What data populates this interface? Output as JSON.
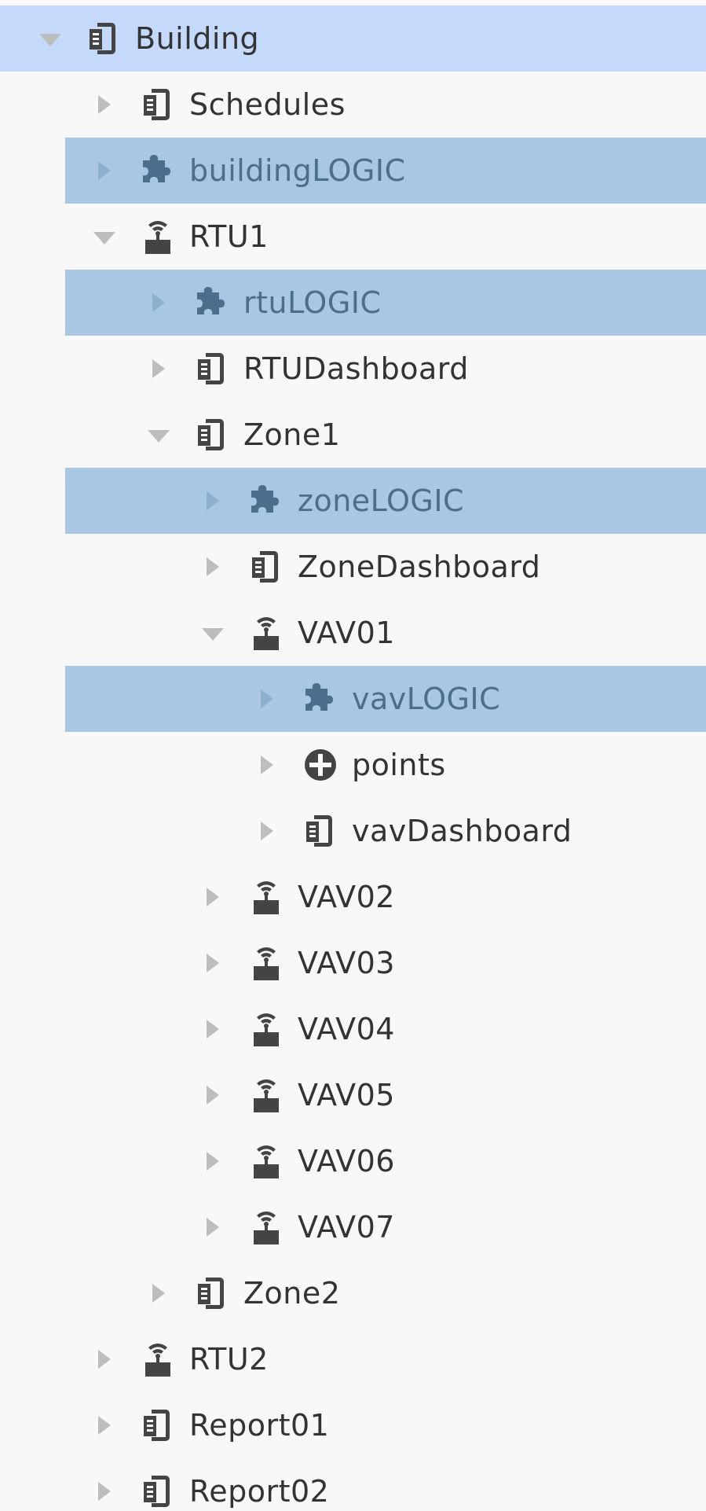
{
  "colors": {
    "root_selected_bg": "#c5d9fb",
    "logic_highlight_bg": "#a9c6e3",
    "label_text": "#333333",
    "logic_label_text": "#4d6d8c"
  },
  "tree": {
    "items": [
      {
        "label": "Building",
        "icon": "document-icon",
        "state": "expanded",
        "depth": 0,
        "style": "selected-root"
      },
      {
        "label": "Schedules",
        "icon": "document-icon",
        "state": "collapsed",
        "depth": 1,
        "style": ""
      },
      {
        "label": "buildingLOGIC",
        "icon": "puzzle-icon",
        "state": "collapsed",
        "depth": 1,
        "style": "highlighted"
      },
      {
        "label": "RTU1",
        "icon": "device-icon",
        "state": "expanded",
        "depth": 1,
        "style": ""
      },
      {
        "label": "rtuLOGIC",
        "icon": "puzzle-icon",
        "state": "collapsed",
        "depth": 2,
        "style": "highlighted"
      },
      {
        "label": "RTUDashboard",
        "icon": "document-icon",
        "state": "collapsed",
        "depth": 2,
        "style": ""
      },
      {
        "label": "Zone1",
        "icon": "document-icon",
        "state": "expanded",
        "depth": 2,
        "style": ""
      },
      {
        "label": "zoneLOGIC",
        "icon": "puzzle-icon",
        "state": "collapsed",
        "depth": 3,
        "style": "highlighted"
      },
      {
        "label": "ZoneDashboard",
        "icon": "document-icon",
        "state": "collapsed",
        "depth": 3,
        "style": ""
      },
      {
        "label": "VAV01",
        "icon": "device-icon",
        "state": "expanded",
        "depth": 3,
        "style": ""
      },
      {
        "label": "vavLOGIC",
        "icon": "puzzle-icon",
        "state": "collapsed",
        "depth": 4,
        "style": "highlighted"
      },
      {
        "label": "points",
        "icon": "points-icon",
        "state": "collapsed",
        "depth": 4,
        "style": ""
      },
      {
        "label": "vavDashboard",
        "icon": "document-icon",
        "state": "collapsed",
        "depth": 4,
        "style": ""
      },
      {
        "label": "VAV02",
        "icon": "device-icon",
        "state": "collapsed",
        "depth": 3,
        "style": ""
      },
      {
        "label": "VAV03",
        "icon": "device-icon",
        "state": "collapsed",
        "depth": 3,
        "style": ""
      },
      {
        "label": "VAV04",
        "icon": "device-icon",
        "state": "collapsed",
        "depth": 3,
        "style": ""
      },
      {
        "label": "VAV05",
        "icon": "device-icon",
        "state": "collapsed",
        "depth": 3,
        "style": ""
      },
      {
        "label": "VAV06",
        "icon": "device-icon",
        "state": "collapsed",
        "depth": 3,
        "style": ""
      },
      {
        "label": "VAV07",
        "icon": "device-icon",
        "state": "collapsed",
        "depth": 3,
        "style": ""
      },
      {
        "label": "Zone2",
        "icon": "document-icon",
        "state": "collapsed",
        "depth": 2,
        "style": ""
      },
      {
        "label": "RTU2",
        "icon": "device-icon",
        "state": "collapsed",
        "depth": 1,
        "style": ""
      },
      {
        "label": "Report01",
        "icon": "document-icon",
        "state": "collapsed",
        "depth": 1,
        "style": ""
      },
      {
        "label": "Report02",
        "icon": "document-icon",
        "state": "collapsed",
        "depth": 1,
        "style": ""
      }
    ]
  }
}
